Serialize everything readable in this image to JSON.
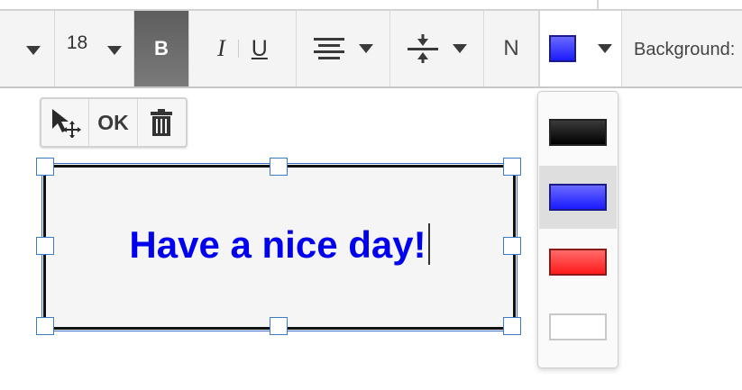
{
  "toolbar": {
    "font_size": "18",
    "bold_label": "B",
    "italic_label": "I",
    "underline_label": "U",
    "n_label": "N",
    "current_color": "#2020ff",
    "background_label": "Background:"
  },
  "mini_toolbar": {
    "ok_label": "OK"
  },
  "text_box": {
    "text": "Have a nice day!",
    "text_color": "#0000ee"
  },
  "color_options": [
    {
      "name": "black",
      "color": "#111111",
      "selected": false
    },
    {
      "name": "blue",
      "color": "#2020ff",
      "selected": true
    },
    {
      "name": "red",
      "color": "#ff2020",
      "selected": false
    },
    {
      "name": "white",
      "color": "#ffffff",
      "selected": false
    }
  ]
}
